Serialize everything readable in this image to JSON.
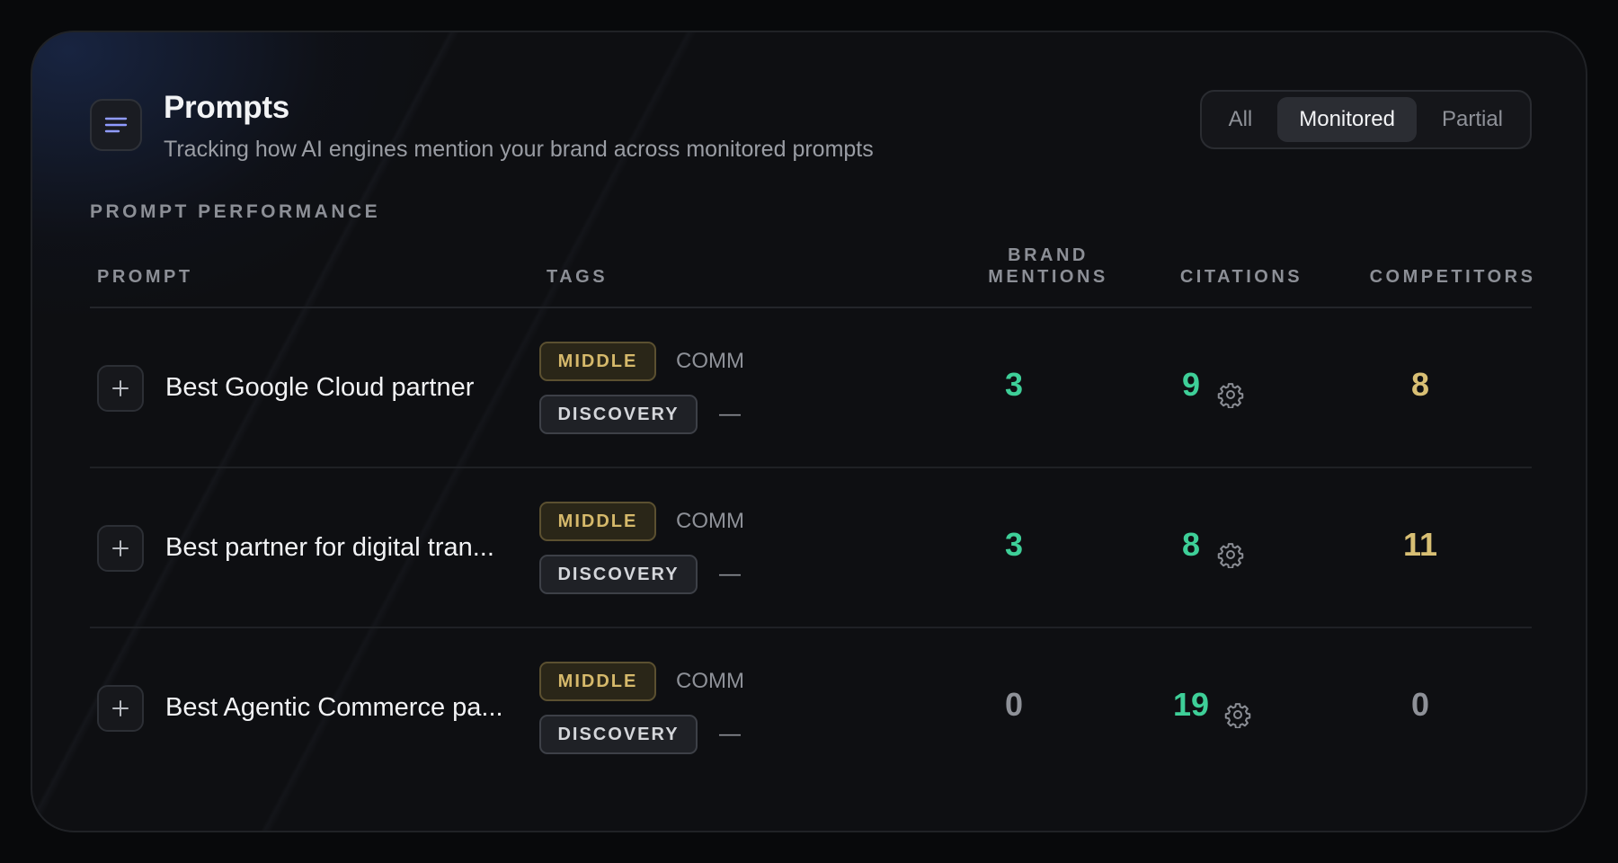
{
  "header": {
    "title": "Prompts",
    "subtitle": "Tracking how AI engines mention your brand across monitored prompts",
    "filters": [
      {
        "label": "All",
        "active": false
      },
      {
        "label": "Monitored",
        "active": true
      },
      {
        "label": "Partial",
        "active": false
      }
    ]
  },
  "section_label": "PROMPT PERFORMANCE",
  "columns": {
    "prompt": "PROMPT",
    "tags": "TAGS",
    "brand_mentions_line1": "BRAND",
    "brand_mentions_line2": "MENTIONS",
    "citations": "CITATIONS",
    "competitors": "COMPETITORS"
  },
  "rows": [
    {
      "prompt": "Best Google Cloud partner",
      "tag_stage": "MIDDLE",
      "tag_intent": "COMM",
      "tag_type": "DISCOVERY",
      "tag_extra": "—",
      "brand_mentions": "3",
      "citations": "9",
      "competitors": "8"
    },
    {
      "prompt": "Best partner for digital tran...",
      "tag_stage": "MIDDLE",
      "tag_intent": "COMM",
      "tag_type": "DISCOVERY",
      "tag_extra": "—",
      "brand_mentions": "3",
      "citations": "8",
      "competitors": "11"
    },
    {
      "prompt": "Best Agentic Commerce pa...",
      "tag_stage": "MIDDLE",
      "tag_intent": "COMM",
      "tag_type": "DISCOVERY",
      "tag_extra": "—",
      "brand_mentions": "0",
      "citations": "19",
      "competitors": "0"
    }
  ],
  "colors": {
    "positive": "#3ecf98",
    "warning": "#d8bf74",
    "neutral": "#8e9198"
  },
  "icons": {
    "menu": "menu-lines-icon",
    "expand": "plus-icon",
    "citations": "gear-icon"
  }
}
